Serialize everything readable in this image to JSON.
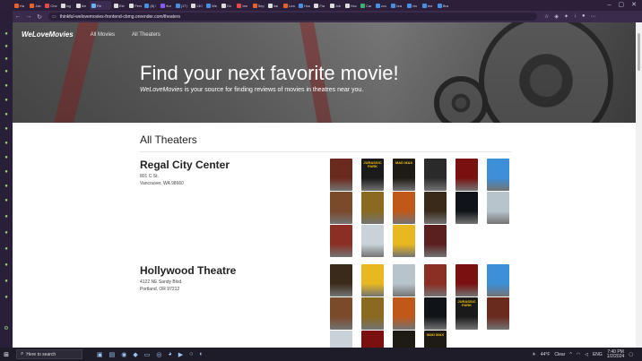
{
  "browser": {
    "tabs": [
      {
        "label": "Ha",
        "color": "#e8632b"
      },
      {
        "label": "Job",
        "color": "#e8632b"
      },
      {
        "label": "Che",
        "color": "#e34a4a"
      },
      {
        "label": "log",
        "color": "#dddddd"
      },
      {
        "label": "the",
        "color": "#dddddd"
      },
      {
        "label": "Re",
        "color": "#6ab0f3",
        "active": true
      },
      {
        "label": "Ele",
        "color": "#dddddd"
      },
      {
        "label": "Pers",
        "color": "#dddddd"
      },
      {
        "label": "(8) I",
        "color": "#4a90e2"
      },
      {
        "label": "Hur",
        "color": "#8a5cf6"
      },
      {
        "label": "(17)",
        "color": "#4a90e2"
      },
      {
        "label": "130",
        "color": "#dddddd"
      },
      {
        "label": "We",
        "color": "#4a90e2"
      },
      {
        "label": "Do",
        "color": "#dddddd"
      },
      {
        "label": "bre",
        "color": "#e34a4a"
      },
      {
        "label": "Sep",
        "color": "#e8632b"
      },
      {
        "label": "hai",
        "color": "#dddddd"
      },
      {
        "label": "Lea",
        "color": "#e8632b"
      },
      {
        "label": "Hoc",
        "color": "#4a90e2"
      },
      {
        "label": "Fla",
        "color": "#dddddd"
      },
      {
        "label": "Job",
        "color": "#dddddd"
      },
      {
        "label": "Hoc",
        "color": "#dddddd"
      },
      {
        "label": "Car",
        "color": "#3cb371"
      },
      {
        "label": "cov",
        "color": "#4a90e2"
      },
      {
        "label": "bra",
        "color": "#4a90e2"
      },
      {
        "label": "bro",
        "color": "#4a90e2"
      },
      {
        "label": "bra",
        "color": "#4a90e2"
      },
      {
        "label": "Bra",
        "color": "#4a90e2"
      }
    ],
    "url_host": "thinkful-welovemovies-frontend-cbmg.onrender.com",
    "url_path": "/theaters"
  },
  "site": {
    "brand": "WeLoveMovies",
    "nav": [
      "All Movies",
      "All Theaters"
    ],
    "hero_title": "Find your next favorite movie!",
    "hero_sub_brand": "WeLoveMovies",
    "hero_sub_rest": " is your source for finding reviews of movies in theatres near you."
  },
  "main": {
    "section_title": "All Theaters",
    "theaters": [
      {
        "name": "Regal City Center",
        "address1": "801 C St.",
        "address2": "Vancouver, WA 98660",
        "posters": [
          {
            "bg": "#6b2a1e",
            "title": ""
          },
          {
            "bg": "#1a1a1a",
            "title": "JURASSIC PARK"
          },
          {
            "bg": "#1e1a14",
            "title": "MAD MAX"
          },
          {
            "bg": "#2a2a2a",
            "title": ""
          },
          {
            "bg": "#7a1010",
            "title": ""
          },
          {
            "bg": "#3d8fd8",
            "title": ""
          },
          {
            "bg": "#7a4a2a",
            "title": ""
          },
          {
            "bg": "#8a6a20",
            "title": ""
          },
          {
            "bg": "#c0581a",
            "title": ""
          },
          {
            "bg": "#3a2a1a",
            "title": ""
          },
          {
            "bg": "#101418",
            "title": ""
          },
          {
            "bg": "#b8c4cc",
            "title": ""
          },
          {
            "bg": "#8b2e24",
            "title": ""
          },
          {
            "bg": "#c8d2d8",
            "title": ""
          },
          {
            "bg": "#e8b820",
            "title": ""
          },
          {
            "bg": "#5a2020",
            "title": ""
          }
        ]
      },
      {
        "name": "Hollywood Theatre",
        "address1": "4122 NE Sandy Blvd.",
        "address2": "Portland, OR 97212",
        "posters": [
          {
            "bg": "#3a2a1a",
            "title": ""
          },
          {
            "bg": "#e8b820",
            "title": ""
          },
          {
            "bg": "#b8c4cc",
            "title": ""
          },
          {
            "bg": "#8b2e24",
            "title": ""
          },
          {
            "bg": "#7a1010",
            "title": ""
          },
          {
            "bg": "#3d8fd8",
            "title": ""
          },
          {
            "bg": "#7a4a2a",
            "title": ""
          },
          {
            "bg": "#8a6a20",
            "title": ""
          },
          {
            "bg": "#c0581a",
            "title": ""
          },
          {
            "bg": "#101418",
            "title": ""
          },
          {
            "bg": "#1a1a1a",
            "title": "JURASSIC PARK"
          },
          {
            "bg": "#6b2a1e",
            "title": ""
          },
          {
            "bg": "#c8d2d8",
            "title": ""
          },
          {
            "bg": "#7a1010",
            "title": ""
          },
          {
            "bg": "#1e1a14",
            "title": ""
          },
          {
            "bg": "#1e1a14",
            "title": "MAD MAX"
          }
        ]
      }
    ]
  },
  "taskbar": {
    "search_placeholder": "Here to search",
    "weather": "44°F",
    "weather_desc": "Clear",
    "lang": "ENG",
    "time": "7:40 PM",
    "date": "1/2/2024"
  }
}
